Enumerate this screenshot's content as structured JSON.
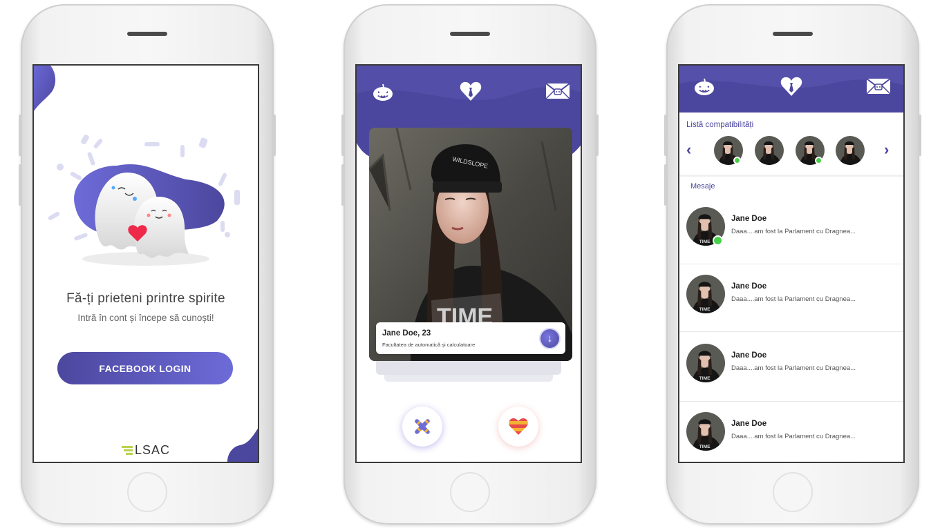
{
  "screens": {
    "login": {
      "title": "Fă-ți prieteni printre spirite",
      "subtitle": "Intră în cont și începe să cunoști!",
      "facebook_button": "FACEBOOK LOGIN",
      "logo_text": "LSAC"
    },
    "swipe": {
      "header_icons": [
        "pumpkin-icon",
        "heart-tie-icon",
        "envelope-icon"
      ],
      "profile": {
        "name_age": "Jane Doe, 23",
        "faculty": "Facultatea de automatică și calculatoare"
      },
      "actions": [
        "candy-cross-button",
        "heart-button"
      ]
    },
    "messages": {
      "header_icons": [
        "pumpkin-icon",
        "heart-tie-icon",
        "envelope-icon"
      ],
      "matches_label": "Listă compatibilități",
      "messages_label": "Mesaje",
      "matches": [
        {
          "online": true
        },
        {
          "online": false
        },
        {
          "online": true
        },
        {
          "online": false
        }
      ],
      "threads": [
        {
          "name": "Jane Doe",
          "preview": "Daaa....am fost la Parlament cu Dragnea...",
          "online": true
        },
        {
          "name": "Jane Doe",
          "preview": "Daaa....am fost la Parlament cu Dragnea...",
          "online": false
        },
        {
          "name": "Jane Doe",
          "preview": "Daaa....am fost la Parlament cu Dragnea...",
          "online": false
        },
        {
          "name": "Jane Doe",
          "preview": "Daaa....am fost la Parlament cu Dragnea...",
          "online": false
        }
      ]
    }
  },
  "colors": {
    "brand": "#4c479e",
    "brand_light": "#6d6bd8",
    "online": "#49d04a"
  }
}
